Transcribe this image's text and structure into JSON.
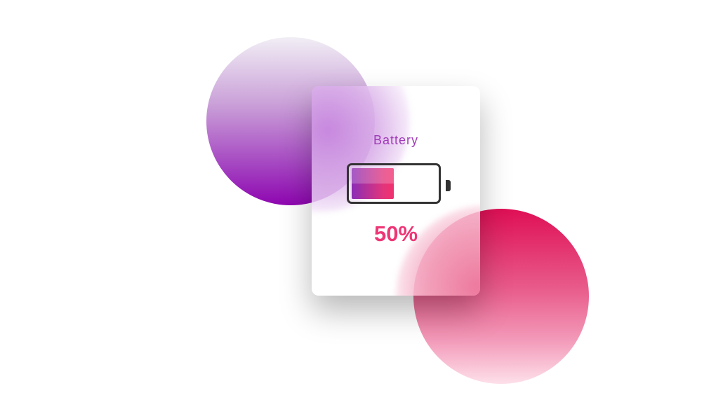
{
  "battery": {
    "title": "Battery",
    "level_percent": 50,
    "level_label": "50%"
  },
  "colors": {
    "title": "#a03ab8",
    "percent": "#ee3676",
    "fill_start": "#8a2db6",
    "fill_end": "#f2306f",
    "blob_purple": "#8e06b0",
    "blob_pink": "#df0f55"
  }
}
